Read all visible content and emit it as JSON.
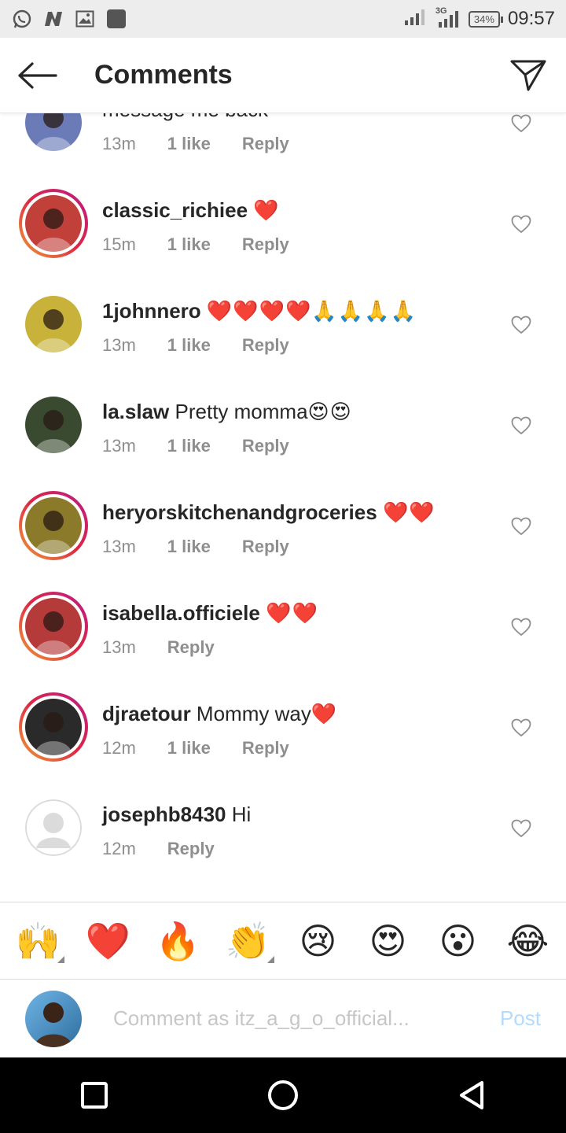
{
  "status_bar": {
    "time": "09:57",
    "battery": "34%",
    "network": "3G",
    "left_icons": [
      "whatsapp-icon",
      "n-app-icon",
      "gallery-icon",
      "app-square-icon"
    ]
  },
  "header": {
    "title": "Comments",
    "back_icon": "arrow-left-icon",
    "share_icon": "paper-plane-icon"
  },
  "comments": [
    {
      "username": "",
      "text": "message me back",
      "emoji": "",
      "time": "13m",
      "likes": "1 like",
      "reply": "Reply",
      "ring": false,
      "avatar_color": "#6a7bb8",
      "avatar_type": "photo"
    },
    {
      "username": "classic_richiee",
      "text": "",
      "emoji": "❤️",
      "time": "15m",
      "likes": "1 like",
      "reply": "Reply",
      "ring": true,
      "avatar_color": "#c2403a",
      "avatar_type": "photo"
    },
    {
      "username": "1johnnero",
      "text": "",
      "emoji": "❤️❤️❤️❤️🙏🙏🙏🙏",
      "time": "13m",
      "likes": "1 like",
      "reply": "Reply",
      "ring": false,
      "avatar_color": "#c8b23a",
      "avatar_type": "photo"
    },
    {
      "username": "la.slaw",
      "text": "Pretty momma",
      "emoji": "😍😍",
      "time": "13m",
      "likes": "1 like",
      "reply": "Reply",
      "ring": false,
      "avatar_color": "#3a4a30",
      "avatar_type": "photo"
    },
    {
      "username": "heryorskitchenandgroceries",
      "text": "",
      "emoji": "❤️❤️",
      "time": "13m",
      "likes": "1 like",
      "reply": "Reply",
      "ring": true,
      "avatar_color": "#8a7a2a",
      "avatar_type": "photo"
    },
    {
      "username": "isabella.officiele",
      "text": "",
      "emoji": "❤️❤️",
      "time": "13m",
      "likes": "",
      "reply": "Reply",
      "ring": true,
      "avatar_color": "#b53a3a",
      "avatar_type": "photo"
    },
    {
      "username": "djraetour",
      "text": "Mommy way",
      "emoji": "❤️",
      "time": "12m",
      "likes": "1 like",
      "reply": "Reply",
      "ring": true,
      "avatar_color": "#2a2a2a",
      "avatar_type": "photo"
    },
    {
      "username": "josephb8430",
      "text": "Hi",
      "emoji": "",
      "time": "12m",
      "likes": "",
      "reply": "Reply",
      "ring": false,
      "avatar_color": "#dbdbdb",
      "avatar_type": "default"
    }
  ],
  "emoji_bar": [
    {
      "emoji": "🙌",
      "name": "raising-hands-emoji",
      "has_variants": true
    },
    {
      "emoji": "❤️",
      "name": "red-heart-emoji",
      "has_variants": false
    },
    {
      "emoji": "🔥",
      "name": "fire-emoji",
      "has_variants": false
    },
    {
      "emoji": "👏",
      "name": "clapping-hands-emoji",
      "has_variants": true
    },
    {
      "emoji": "😢",
      "name": "crying-face-emoji",
      "has_variants": false
    },
    {
      "emoji": "😍",
      "name": "heart-eyes-emoji",
      "has_variants": false
    },
    {
      "emoji": "😮",
      "name": "surprised-face-emoji",
      "has_variants": false
    },
    {
      "emoji": "😂",
      "name": "tears-of-joy-emoji",
      "has_variants": false
    }
  ],
  "composer": {
    "placeholder": "Comment as itz_a_g_o_official...",
    "post_label": "Post",
    "avatar_color": "#5a8cc0"
  },
  "colors": {
    "accent_link": "#b3dbff",
    "story_ring_start": "#f09433",
    "story_ring_end": "#bc1888",
    "meta_text": "#8e8e8e"
  }
}
